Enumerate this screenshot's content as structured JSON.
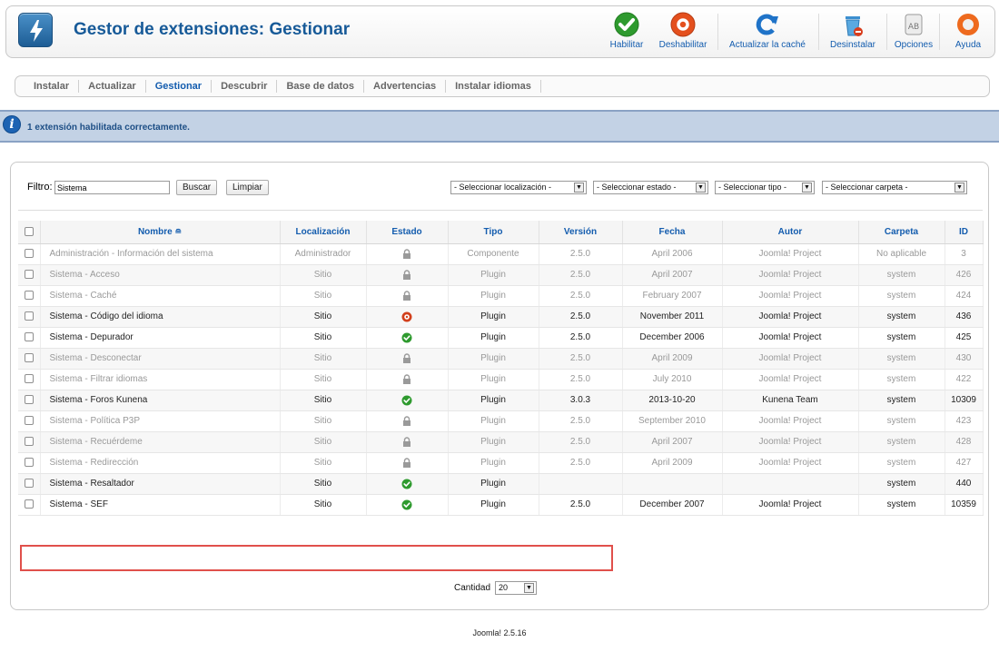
{
  "header": {
    "title": "Gestor de extensiones: Gestionar",
    "toolbar": [
      {
        "id": "enable",
        "label": "Habilitar",
        "icon": "check-icon"
      },
      {
        "id": "disable",
        "label": "Deshabilitar",
        "icon": "disable-icon"
      },
      {
        "id": "refresh",
        "label": "Actualizar la caché",
        "icon": "refresh-icon"
      },
      {
        "id": "uninstall",
        "label": "Desinstalar",
        "icon": "trash-icon"
      },
      {
        "id": "options",
        "label": "Opciones",
        "icon": "options-icon"
      },
      {
        "id": "help",
        "label": "Ayuda",
        "icon": "help-icon"
      }
    ]
  },
  "submenu": [
    "Instalar",
    "Actualizar",
    "Gestionar",
    "Descubrir",
    "Base de datos",
    "Advertencias",
    "Instalar idiomas"
  ],
  "message": "1 extensión habilitada correctamente.",
  "filter": {
    "label": "Filtro:",
    "value": "Sistema",
    "search_label": "Buscar",
    "clear_label": "Limpiar",
    "selects": [
      "- Seleccionar localización -",
      "- Seleccionar estado -",
      "- Seleccionar tipo -",
      "- Seleccionar carpeta -"
    ]
  },
  "table": {
    "columns": [
      "Nombre",
      "Localización",
      "Estado",
      "Tipo",
      "Versión",
      "Fecha",
      "Autor",
      "Carpeta",
      "ID"
    ],
    "rows": [
      {
        "name": "Administración - Información del sistema",
        "location": "Administrador",
        "status": "locked",
        "type": "Componente",
        "version": "2.5.0",
        "date": "April 2006",
        "author": "Joomla! Project",
        "folder": "No aplicable",
        "id": "3"
      },
      {
        "name": "Sistema - Acceso",
        "location": "Sitio",
        "status": "locked",
        "type": "Plugin",
        "version": "2.5.0",
        "date": "April 2007",
        "author": "Joomla! Project",
        "folder": "system",
        "id": "426"
      },
      {
        "name": "Sistema - Caché",
        "location": "Sitio",
        "status": "locked",
        "type": "Plugin",
        "version": "2.5.0",
        "date": "February 2007",
        "author": "Joomla! Project",
        "folder": "system",
        "id": "424"
      },
      {
        "name": "Sistema - Código del idioma",
        "location": "Sitio",
        "status": "disabled",
        "type": "Plugin",
        "version": "2.5.0",
        "date": "November 2011",
        "author": "Joomla! Project",
        "folder": "system",
        "id": "436"
      },
      {
        "name": "Sistema - Depurador",
        "location": "Sitio",
        "status": "enabled",
        "type": "Plugin",
        "version": "2.5.0",
        "date": "December 2006",
        "author": "Joomla! Project",
        "folder": "system",
        "id": "425"
      },
      {
        "name": "Sistema - Desconectar",
        "location": "Sitio",
        "status": "locked",
        "type": "Plugin",
        "version": "2.5.0",
        "date": "April 2009",
        "author": "Joomla! Project",
        "folder": "system",
        "id": "430"
      },
      {
        "name": "Sistema - Filtrar idiomas",
        "location": "Sitio",
        "status": "locked",
        "type": "Plugin",
        "version": "2.5.0",
        "date": "July 2010",
        "author": "Joomla! Project",
        "folder": "system",
        "id": "422"
      },
      {
        "name": "Sistema - Foros Kunena",
        "location": "Sitio",
        "status": "enabled",
        "type": "Plugin",
        "version": "3.0.3",
        "date": "2013-10-20",
        "author": "Kunena Team",
        "folder": "system",
        "id": "10309"
      },
      {
        "name": "Sistema - Política P3P",
        "location": "Sitio",
        "status": "locked",
        "type": "Plugin",
        "version": "2.5.0",
        "date": "September 2010",
        "author": "Joomla! Project",
        "folder": "system",
        "id": "423"
      },
      {
        "name": "Sistema - Recuérdeme",
        "location": "Sitio",
        "status": "locked",
        "type": "Plugin",
        "version": "2.5.0",
        "date": "April 2007",
        "author": "Joomla! Project",
        "folder": "system",
        "id": "428"
      },
      {
        "name": "Sistema - Redirección",
        "location": "Sitio",
        "status": "locked",
        "type": "Plugin",
        "version": "2.5.0",
        "date": "April 2009",
        "author": "Joomla! Project",
        "folder": "system",
        "id": "427"
      },
      {
        "name": "Sistema - Resaltador",
        "location": "Sitio",
        "status": "enabled",
        "type": "Plugin",
        "version": "",
        "date": "",
        "author": "",
        "folder": "system",
        "id": "440"
      },
      {
        "name": "Sistema - SEF",
        "location": "Sitio",
        "status": "enabled",
        "type": "Plugin",
        "version": "2.5.0",
        "date": "December 2007",
        "author": "Joomla! Project",
        "folder": "system",
        "id": "10359"
      }
    ]
  },
  "pagination": {
    "label": "Cantidad",
    "value": "20"
  },
  "footer": "Joomla! 2.5.16",
  "colors": {
    "title": "#175a98",
    "link": "#135cae",
    "enabled": "#2e9a2e",
    "disabled": "#d2401c",
    "highlight": "#e0504b"
  }
}
